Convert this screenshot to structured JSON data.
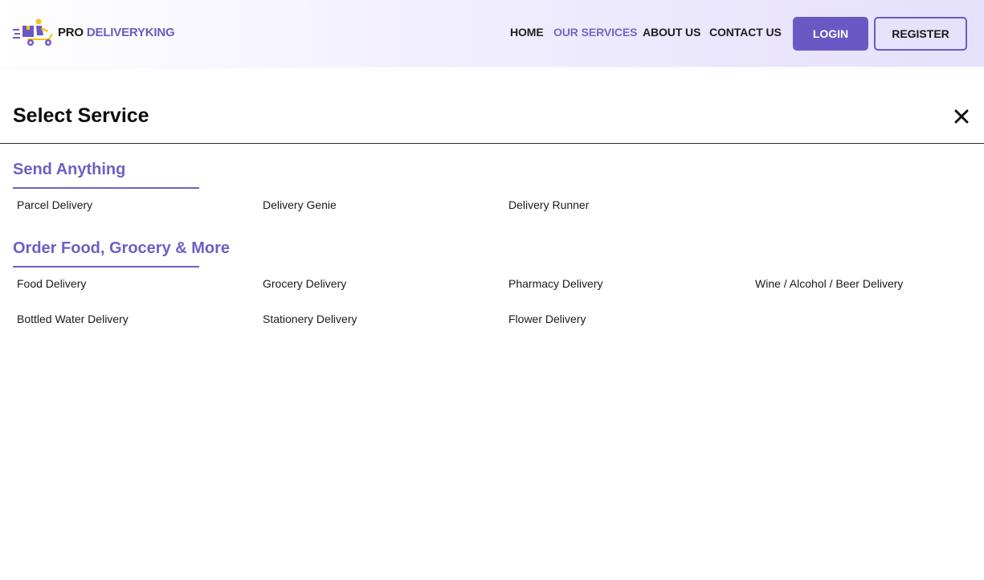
{
  "brand": {
    "pro": "PRO",
    "name": "DELIVERYKING"
  },
  "nav": [
    {
      "label": "HOME",
      "active": false
    },
    {
      "label": "OUR SERVICES",
      "active": true
    },
    {
      "label": "ABOUT US",
      "active": false
    },
    {
      "label": "CONTACT US",
      "active": false
    }
  ],
  "buttons": {
    "login": "LOGIN",
    "register": "REGISTER"
  },
  "panel": {
    "title": "Select Service"
  },
  "sections": [
    {
      "title": "Send Anything",
      "items": [
        "Parcel Delivery",
        "Delivery Genie",
        "Delivery Runner"
      ]
    },
    {
      "title": "Order Food, Grocery & More",
      "items": [
        "Food Delivery",
        "Grocery Delivery",
        "Pharmacy Delivery",
        "Wine / Alcohol / Beer Delivery",
        "Bottled Water Delivery",
        "Stationery Delivery",
        "Flower Delivery"
      ]
    }
  ],
  "colors": {
    "accent": "#6a59c4",
    "section_title": "#6f5fc4",
    "logo_yellow": "#f5c518"
  },
  "icons": {
    "logo": "delivery-scooter-icon",
    "close": "close-icon"
  }
}
